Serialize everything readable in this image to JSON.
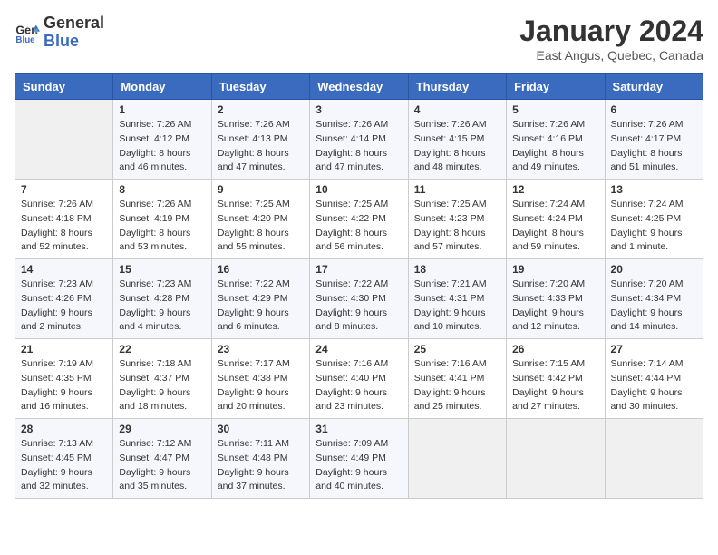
{
  "header": {
    "logo_line1": "General",
    "logo_line2": "Blue",
    "month_title": "January 2024",
    "location": "East Angus, Quebec, Canada"
  },
  "weekdays": [
    "Sunday",
    "Monday",
    "Tuesday",
    "Wednesday",
    "Thursday",
    "Friday",
    "Saturday"
  ],
  "weeks": [
    [
      {
        "day": "",
        "sunrise": "",
        "sunset": "",
        "daylight": ""
      },
      {
        "day": "1",
        "sunrise": "Sunrise: 7:26 AM",
        "sunset": "Sunset: 4:12 PM",
        "daylight": "Daylight: 8 hours and 46 minutes."
      },
      {
        "day": "2",
        "sunrise": "Sunrise: 7:26 AM",
        "sunset": "Sunset: 4:13 PM",
        "daylight": "Daylight: 8 hours and 47 minutes."
      },
      {
        "day": "3",
        "sunrise": "Sunrise: 7:26 AM",
        "sunset": "Sunset: 4:14 PM",
        "daylight": "Daylight: 8 hours and 47 minutes."
      },
      {
        "day": "4",
        "sunrise": "Sunrise: 7:26 AM",
        "sunset": "Sunset: 4:15 PM",
        "daylight": "Daylight: 8 hours and 48 minutes."
      },
      {
        "day": "5",
        "sunrise": "Sunrise: 7:26 AM",
        "sunset": "Sunset: 4:16 PM",
        "daylight": "Daylight: 8 hours and 49 minutes."
      },
      {
        "day": "6",
        "sunrise": "Sunrise: 7:26 AM",
        "sunset": "Sunset: 4:17 PM",
        "daylight": "Daylight: 8 hours and 51 minutes."
      }
    ],
    [
      {
        "day": "7",
        "sunrise": "Sunrise: 7:26 AM",
        "sunset": "Sunset: 4:18 PM",
        "daylight": "Daylight: 8 hours and 52 minutes."
      },
      {
        "day": "8",
        "sunrise": "Sunrise: 7:26 AM",
        "sunset": "Sunset: 4:19 PM",
        "daylight": "Daylight: 8 hours and 53 minutes."
      },
      {
        "day": "9",
        "sunrise": "Sunrise: 7:25 AM",
        "sunset": "Sunset: 4:20 PM",
        "daylight": "Daylight: 8 hours and 55 minutes."
      },
      {
        "day": "10",
        "sunrise": "Sunrise: 7:25 AM",
        "sunset": "Sunset: 4:22 PM",
        "daylight": "Daylight: 8 hours and 56 minutes."
      },
      {
        "day": "11",
        "sunrise": "Sunrise: 7:25 AM",
        "sunset": "Sunset: 4:23 PM",
        "daylight": "Daylight: 8 hours and 57 minutes."
      },
      {
        "day": "12",
        "sunrise": "Sunrise: 7:24 AM",
        "sunset": "Sunset: 4:24 PM",
        "daylight": "Daylight: 8 hours and 59 minutes."
      },
      {
        "day": "13",
        "sunrise": "Sunrise: 7:24 AM",
        "sunset": "Sunset: 4:25 PM",
        "daylight": "Daylight: 9 hours and 1 minute."
      }
    ],
    [
      {
        "day": "14",
        "sunrise": "Sunrise: 7:23 AM",
        "sunset": "Sunset: 4:26 PM",
        "daylight": "Daylight: 9 hours and 2 minutes."
      },
      {
        "day": "15",
        "sunrise": "Sunrise: 7:23 AM",
        "sunset": "Sunset: 4:28 PM",
        "daylight": "Daylight: 9 hours and 4 minutes."
      },
      {
        "day": "16",
        "sunrise": "Sunrise: 7:22 AM",
        "sunset": "Sunset: 4:29 PM",
        "daylight": "Daylight: 9 hours and 6 minutes."
      },
      {
        "day": "17",
        "sunrise": "Sunrise: 7:22 AM",
        "sunset": "Sunset: 4:30 PM",
        "daylight": "Daylight: 9 hours and 8 minutes."
      },
      {
        "day": "18",
        "sunrise": "Sunrise: 7:21 AM",
        "sunset": "Sunset: 4:31 PM",
        "daylight": "Daylight: 9 hours and 10 minutes."
      },
      {
        "day": "19",
        "sunrise": "Sunrise: 7:20 AM",
        "sunset": "Sunset: 4:33 PM",
        "daylight": "Daylight: 9 hours and 12 minutes."
      },
      {
        "day": "20",
        "sunrise": "Sunrise: 7:20 AM",
        "sunset": "Sunset: 4:34 PM",
        "daylight": "Daylight: 9 hours and 14 minutes."
      }
    ],
    [
      {
        "day": "21",
        "sunrise": "Sunrise: 7:19 AM",
        "sunset": "Sunset: 4:35 PM",
        "daylight": "Daylight: 9 hours and 16 minutes."
      },
      {
        "day": "22",
        "sunrise": "Sunrise: 7:18 AM",
        "sunset": "Sunset: 4:37 PM",
        "daylight": "Daylight: 9 hours and 18 minutes."
      },
      {
        "day": "23",
        "sunrise": "Sunrise: 7:17 AM",
        "sunset": "Sunset: 4:38 PM",
        "daylight": "Daylight: 9 hours and 20 minutes."
      },
      {
        "day": "24",
        "sunrise": "Sunrise: 7:16 AM",
        "sunset": "Sunset: 4:40 PM",
        "daylight": "Daylight: 9 hours and 23 minutes."
      },
      {
        "day": "25",
        "sunrise": "Sunrise: 7:16 AM",
        "sunset": "Sunset: 4:41 PM",
        "daylight": "Daylight: 9 hours and 25 minutes."
      },
      {
        "day": "26",
        "sunrise": "Sunrise: 7:15 AM",
        "sunset": "Sunset: 4:42 PM",
        "daylight": "Daylight: 9 hours and 27 minutes."
      },
      {
        "day": "27",
        "sunrise": "Sunrise: 7:14 AM",
        "sunset": "Sunset: 4:44 PM",
        "daylight": "Daylight: 9 hours and 30 minutes."
      }
    ],
    [
      {
        "day": "28",
        "sunrise": "Sunrise: 7:13 AM",
        "sunset": "Sunset: 4:45 PM",
        "daylight": "Daylight: 9 hours and 32 minutes."
      },
      {
        "day": "29",
        "sunrise": "Sunrise: 7:12 AM",
        "sunset": "Sunset: 4:47 PM",
        "daylight": "Daylight: 9 hours and 35 minutes."
      },
      {
        "day": "30",
        "sunrise": "Sunrise: 7:11 AM",
        "sunset": "Sunset: 4:48 PM",
        "daylight": "Daylight: 9 hours and 37 minutes."
      },
      {
        "day": "31",
        "sunrise": "Sunrise: 7:09 AM",
        "sunset": "Sunset: 4:49 PM",
        "daylight": "Daylight: 9 hours and 40 minutes."
      },
      {
        "day": "",
        "sunrise": "",
        "sunset": "",
        "daylight": ""
      },
      {
        "day": "",
        "sunrise": "",
        "sunset": "",
        "daylight": ""
      },
      {
        "day": "",
        "sunrise": "",
        "sunset": "",
        "daylight": ""
      }
    ]
  ]
}
